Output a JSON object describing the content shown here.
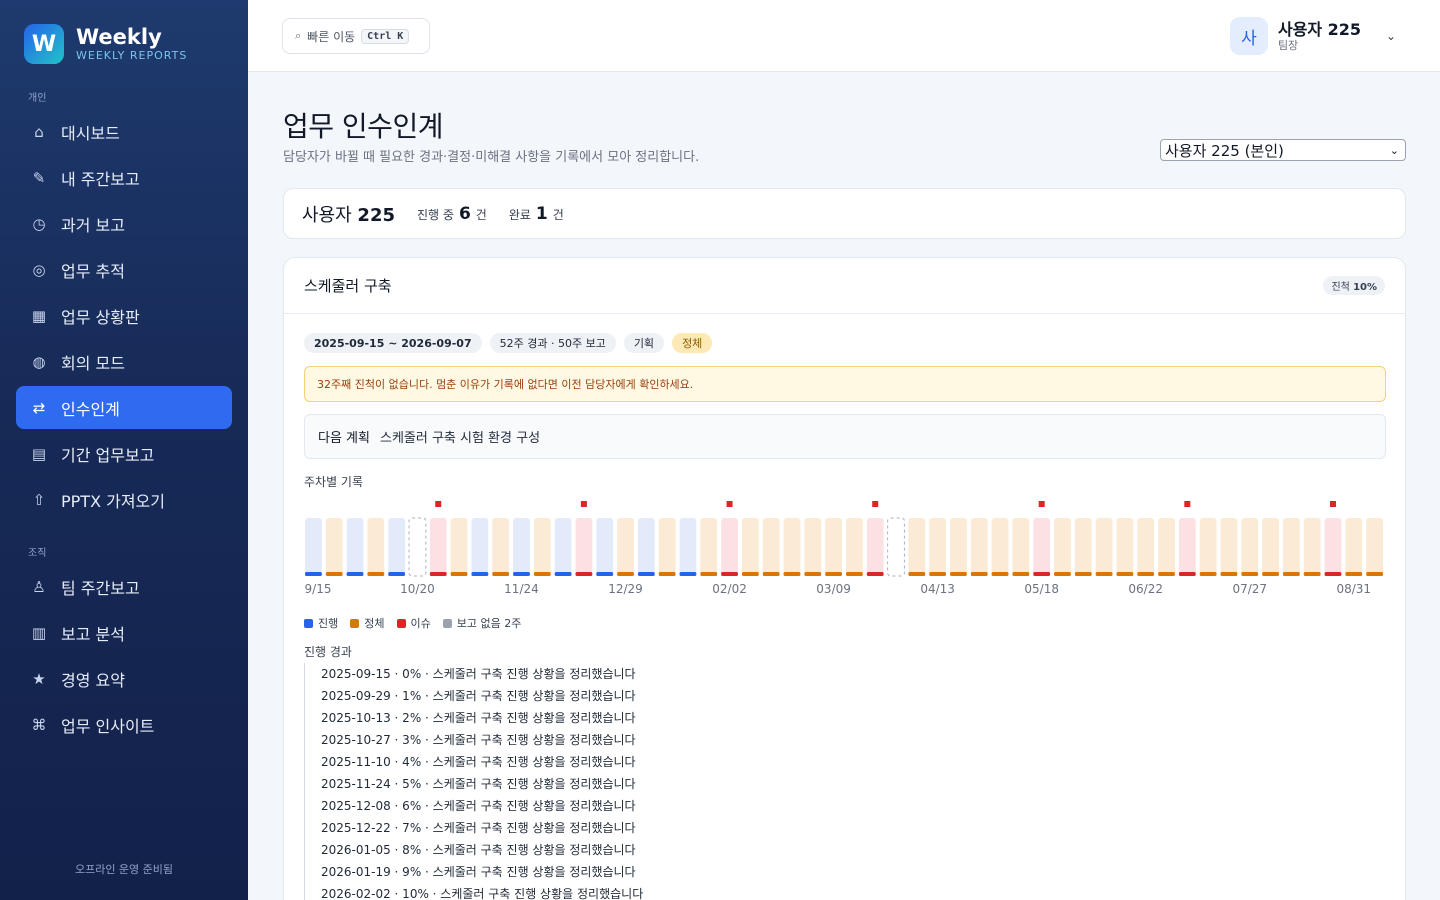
{
  "brand": {
    "logo_letter": "W",
    "title": "Weekly",
    "subtitle": "WEEKLY REPORTS"
  },
  "sidebar": {
    "section_personal": "개인",
    "section_org": "조직",
    "items": [
      {
        "icon": "home-icon",
        "glyph": "⌂",
        "label": "대시보드"
      },
      {
        "icon": "pencil-icon",
        "glyph": "✎",
        "label": "내 주간보고"
      },
      {
        "icon": "clock-icon",
        "glyph": "◷",
        "label": "과거 보고"
      },
      {
        "icon": "target-icon",
        "glyph": "◎",
        "label": "업무 추적"
      },
      {
        "icon": "grid-icon",
        "glyph": "▦",
        "label": "업무 상황판"
      },
      {
        "icon": "globe-icon",
        "glyph": "◍",
        "label": "회의 모드"
      },
      {
        "icon": "swap-icon",
        "glyph": "⇄",
        "label": "인수인계",
        "active": true
      },
      {
        "icon": "document-icon",
        "glyph": "▤",
        "label": "기간 업무보고"
      },
      {
        "icon": "upload-icon",
        "glyph": "⇧",
        "label": "PPTX 가져오기"
      }
    ],
    "org_items": [
      {
        "icon": "team-icon",
        "glyph": "♙",
        "label": "팀 주간보고"
      },
      {
        "icon": "bar-chart-icon",
        "glyph": "▥",
        "label": "보고 분석"
      },
      {
        "icon": "star-icon",
        "glyph": "★",
        "label": "경영 요약"
      },
      {
        "icon": "command-icon",
        "glyph": "⌘",
        "label": "업무 인사이트"
      }
    ],
    "footer": "오프라인 운영 준비됨"
  },
  "topbar": {
    "quick_nav_icon": "search-icon",
    "quick_nav_label": "빠른 이동",
    "quick_nav_shortcut": "Ctrl K",
    "user_avatar": "사",
    "user_name": "사용자 225",
    "user_role": "팀장"
  },
  "page": {
    "title": "업무 인수인계",
    "subtitle": "담당자가 바뀔 때 필요한 경과·결정·미해결 사항을 기록에서 모아 정리합니다.",
    "owner_select": "사용자 225 (본인)"
  },
  "summary": {
    "name_prefix": "사용자",
    "name_number": "225",
    "in_progress_label": "진행 중",
    "in_progress_count": "6",
    "done_label": "완료",
    "done_count": "1",
    "count_unit": "건"
  },
  "task": {
    "title": "스케줄러 구축",
    "progress_label": "진척",
    "progress_value": "10%",
    "period": "2025-09-15 ~ 2026-09-07",
    "weeks_summary": "52주 경과 · 50주 보고",
    "tag_category": "기획",
    "tag_status": "정체",
    "alert": "32주째 진척이 없습니다. 멈춘 이유가 기록에 없다면 이전 담당자에게 확인하세요.",
    "next_plan_label": "다음 계획",
    "next_plan": "스케줄러 구축 시험 환경 구성",
    "weeks_label": "주차별 기록",
    "history_label": "진행 경과",
    "history": [
      "2025-09-15 · 0% · 스케줄러 구축 진행 상황을 정리했습니다",
      "2025-09-29 · 1% · 스케줄러 구축 진행 상황을 정리했습니다",
      "2025-10-13 · 2% · 스케줄러 구축 진행 상황을 정리했습니다",
      "2025-10-27 · 3% · 스케줄러 구축 진행 상황을 정리했습니다",
      "2025-11-10 · 4% · 스케줄러 구축 진행 상황을 정리했습니다",
      "2025-11-24 · 5% · 스케줄러 구축 진행 상황을 정리했습니다",
      "2025-12-08 · 6% · 스케줄러 구축 진행 상황을 정리했습니다",
      "2025-12-22 · 7% · 스케줄러 구축 진행 상황을 정리했습니다",
      "2026-01-05 · 8% · 스케줄러 구축 진행 상황을 정리했습니다",
      "2026-01-19 · 9% · 스케줄러 구축 진행 상황을 정리했습니다",
      "2026-02-02 · 10% · 스케줄러 구축 진행 상황을 정리했습니다"
    ]
  },
  "colors": {
    "progress": "#2563eb",
    "stalled": "#d97706",
    "issue": "#dc2626",
    "missing": "#9ca3af",
    "accent": "#2f6bf0"
  },
  "chart_data": {
    "type": "bar",
    "title": "주차별 기록",
    "tick_labels": [
      "9/15",
      "10/20",
      "11/24",
      "12/29",
      "02/02",
      "03/09",
      "04/13",
      "05/18",
      "06/22",
      "07/27",
      "08/31"
    ],
    "tick_every_weeks": 5,
    "weeks": [
      "p",
      "s",
      "p",
      "s",
      "p",
      "m",
      "i",
      "s",
      "p",
      "s",
      "p",
      "s",
      "p",
      "i",
      "p",
      "s",
      "p",
      "s",
      "p",
      "s",
      "i",
      "s",
      "s",
      "s",
      "s",
      "s",
      "s",
      "i",
      "m",
      "s",
      "s",
      "s",
      "s",
      "s",
      "s",
      "i",
      "s",
      "s",
      "s",
      "s",
      "s",
      "s",
      "i",
      "s",
      "s",
      "s",
      "s",
      "s",
      "s",
      "i",
      "s",
      "s"
    ],
    "issue_markers": [
      6,
      13,
      20,
      27,
      35,
      42,
      49
    ],
    "legend": [
      {
        "key": "p",
        "label": "진행"
      },
      {
        "key": "s",
        "label": "정체"
      },
      {
        "key": "i",
        "label": "이슈"
      },
      {
        "key": "m",
        "label": "보고 없음 2주"
      }
    ]
  }
}
